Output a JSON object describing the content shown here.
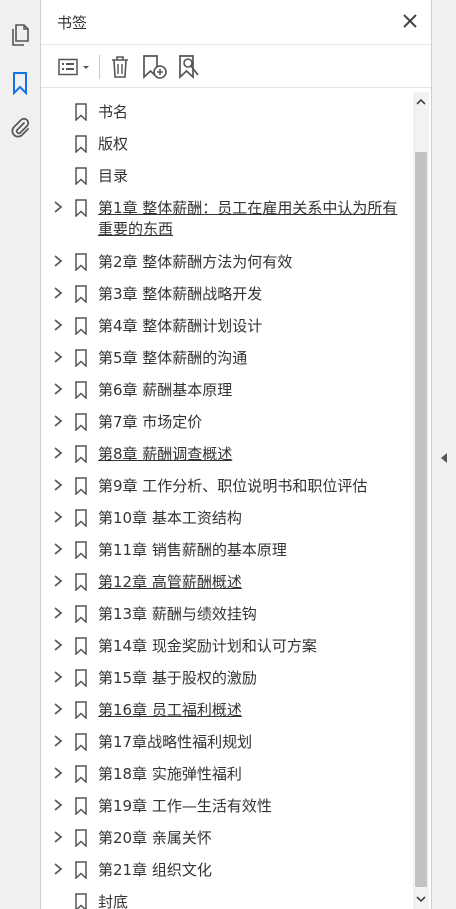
{
  "panel": {
    "title": "书签"
  },
  "bookmarks": [
    {
      "label": "书名",
      "expandable": false,
      "underlined": false
    },
    {
      "label": "版权",
      "expandable": false,
      "underlined": false
    },
    {
      "label": "目录",
      "expandable": false,
      "underlined": false
    },
    {
      "label": "第1章  整体薪酬：员工在雇用关系中认为所有重要的东西",
      "expandable": true,
      "underlined": true
    },
    {
      "label": "第2章  整体薪酬方法为何有效",
      "expandable": true,
      "underlined": false
    },
    {
      "label": "第3章  整体薪酬战略开发",
      "expandable": true,
      "underlined": false
    },
    {
      "label": "第4章  整体薪酬计划设计",
      "expandable": true,
      "underlined": false
    },
    {
      "label": "第5章  整体薪酬的沟通",
      "expandable": true,
      "underlined": false
    },
    {
      "label": "第6章  薪酬基本原理",
      "expandable": true,
      "underlined": false
    },
    {
      "label": "第7章  市场定价",
      "expandable": true,
      "underlined": false
    },
    {
      "label": "第8章  薪酬调查概述",
      "expandable": true,
      "underlined": true
    },
    {
      "label": "第9章  工作分析、职位说明书和职位评估",
      "expandable": true,
      "underlined": false
    },
    {
      "label": "第10章  基本工资结构",
      "expandable": true,
      "underlined": false
    },
    {
      "label": "第11章  销售薪酬的基本原理",
      "expandable": true,
      "underlined": false
    },
    {
      "label": "第12章  高管薪酬概述",
      "expandable": true,
      "underlined": true
    },
    {
      "label": "第13章  薪酬与绩效挂钩",
      "expandable": true,
      "underlined": false
    },
    {
      "label": "第14章  现金奖励计划和认可方案",
      "expandable": true,
      "underlined": false
    },
    {
      "label": "第15章  基于股权的激励",
      "expandable": true,
      "underlined": false
    },
    {
      "label": "第16章  员工福利概述",
      "expandable": true,
      "underlined": true
    },
    {
      "label": "第17章战略性福利规划",
      "expandable": true,
      "underlined": false
    },
    {
      "label": "第18章  实施弹性福利",
      "expandable": true,
      "underlined": false
    },
    {
      "label": "第19章  工作—生活有效性",
      "expandable": true,
      "underlined": false
    },
    {
      "label": "第20章  亲属关怀",
      "expandable": true,
      "underlined": false
    },
    {
      "label": "第21章  组织文化",
      "expandable": true,
      "underlined": false
    },
    {
      "label": "封底",
      "expandable": false,
      "underlined": false
    }
  ],
  "colors": {
    "icon": "#555555",
    "accent": "#1473e6",
    "text": "#333333"
  }
}
